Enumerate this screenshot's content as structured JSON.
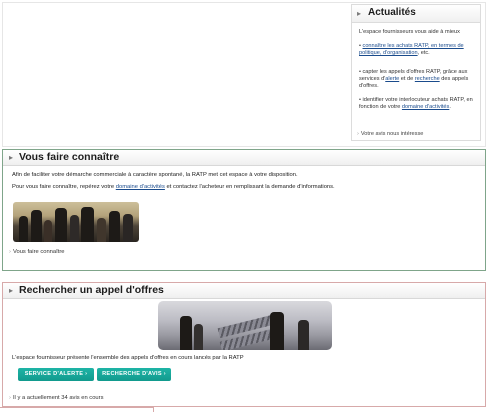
{
  "actualites": {
    "title": "Actualités",
    "intro": "L'espace fournisseurs vous aide à mieux",
    "item1_pre": "• ",
    "item1_link1": "connaître les achats RATP, en termes de politique, d'organisation",
    "item1_post": ", etc.",
    "item2_pre": "• capter les appels d'offres RATP, grâce aux services d'",
    "item2_link1": "alerte",
    "item2_mid": " et de ",
    "item2_link2": "recherche",
    "item2_post": " des appels d'offres.",
    "item3_pre": "• identifier votre interlocuteur achats RATP, en fonction de votre ",
    "item3_link1": "domaine d'activités",
    "item3_post": ".",
    "footer_link": "Votre avis nous intéresse"
  },
  "faire_connaitre": {
    "title": "Vous faire connaître",
    "para1": "Afin de faciliter votre démarche commerciale à caractère spontané, la RATP met cet espace à votre disposition.",
    "para2_pre": "Pour vous faire connaître, repérez votre ",
    "para2_link": "domaine d'activités",
    "para2_post": " et contactez l'acheteur en remplissant la demande d'informations.",
    "footer_link": "Vous faire connaître"
  },
  "appel_offres": {
    "title": "Rechercher un appel d'offres",
    "description": "L'espace fournisseur présente l'ensemble des appels d'offres en cours lancés par la RATP",
    "btn_alerte": "SERVICE D'ALERTE ›",
    "btn_recherche": "RECHERCHE D'AVIS ›",
    "footer_text": "Il y a actuellement 34 avis en cours"
  },
  "icons": {
    "section_chevron": "chevron-right-icon"
  },
  "colors": {
    "button_teal": "#17a99b",
    "link_blue": "#1a4b8c",
    "section2_border": "#7fa58a",
    "section3_border": "#d7a9a9"
  }
}
